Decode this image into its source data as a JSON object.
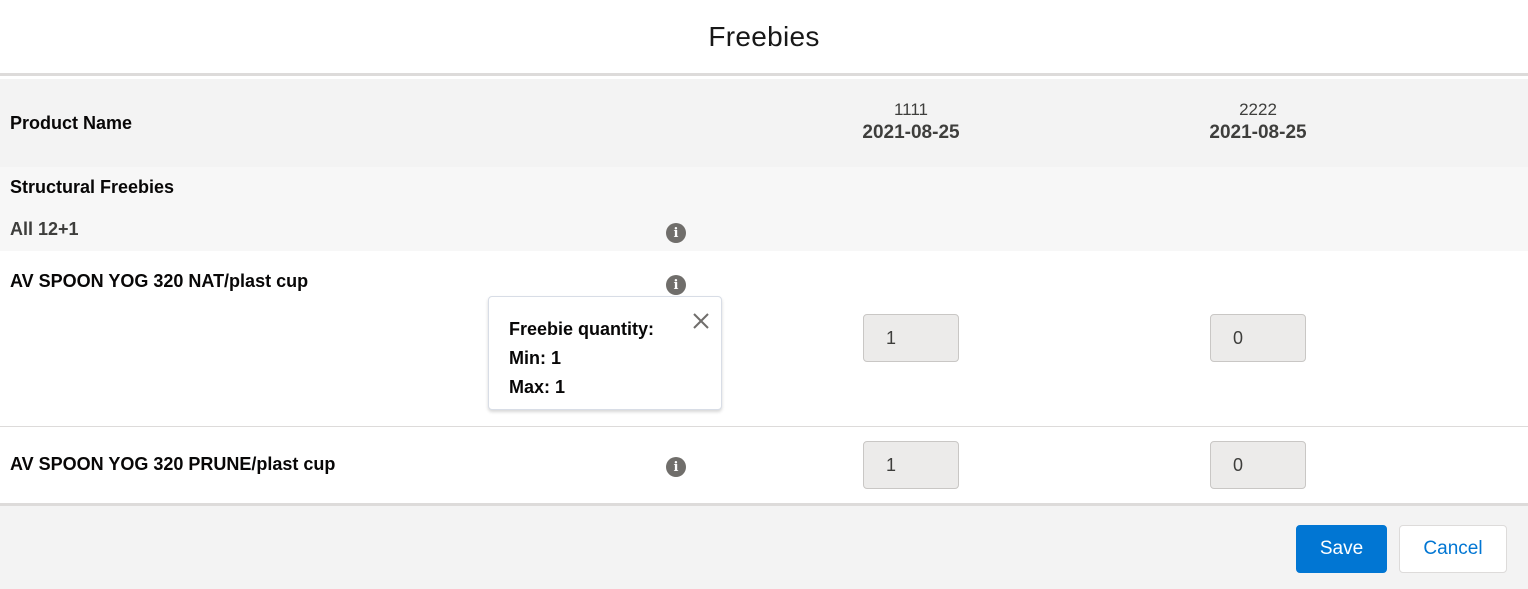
{
  "modal": {
    "title": "Freebies"
  },
  "table": {
    "product_header": "Product Name",
    "columns": [
      {
        "code": "1111",
        "date": "2021-08-25"
      },
      {
        "code": "2222",
        "date": "2021-08-25"
      }
    ],
    "group": {
      "title": "Structural Freebies",
      "subtitle": "All 12+1"
    },
    "rows": [
      {
        "name": "AV SPOON YOG 320 NAT/plast cup",
        "values": [
          "1",
          "0"
        ]
      },
      {
        "name": "AV SPOON YOG 320 PRUNE/plast cup",
        "values": [
          "1",
          "0"
        ]
      }
    ]
  },
  "popover": {
    "line1": "Freebie quantity:",
    "line2": "Min: 1",
    "line3": "Max: 1"
  },
  "icons": {
    "info": "info-icon",
    "close": "close-icon"
  },
  "footer": {
    "save_label": "Save",
    "cancel_label": "Cancel"
  },
  "colors": {
    "brand": "#0176d3",
    "icon": "#706e6b"
  }
}
